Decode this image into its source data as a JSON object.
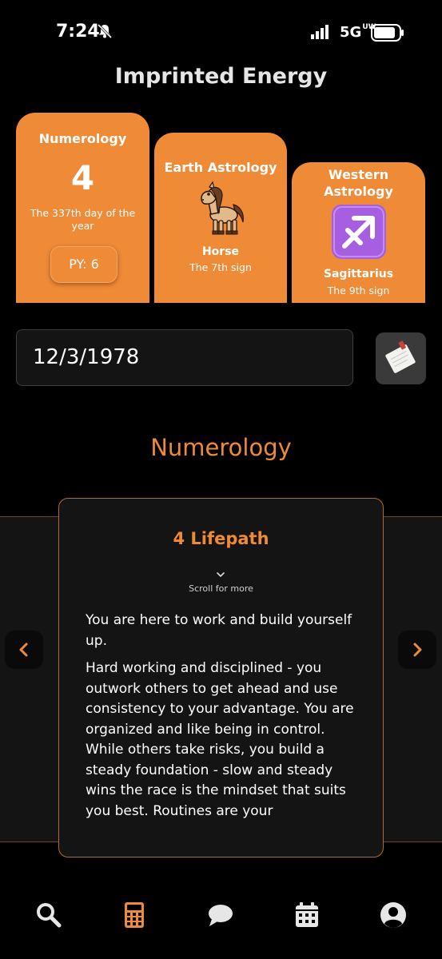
{
  "status_bar": {
    "time": "7:24",
    "network": "5G",
    "network_sup": "UW"
  },
  "page": {
    "title": "Imprinted Energy"
  },
  "cards": {
    "numerology": {
      "title": "Numerology",
      "number": "4",
      "subtitle": "The 337th day of the year",
      "py_label": "PY: 6"
    },
    "earth": {
      "title": "Earth Astrology",
      "icon": "horse-icon",
      "name": "Horse",
      "subtitle": "The 7th sign"
    },
    "western": {
      "title": "Western Astrology",
      "icon": "sagittarius-icon",
      "name": "Sagittarius",
      "subtitle": "The 9th sign"
    }
  },
  "date_input": {
    "value": "12/3/1978"
  },
  "section": {
    "title": "Numerology"
  },
  "panel": {
    "heading": "4 Lifepath",
    "hint": "Scroll for more",
    "paragraphs": [
      "You are here to work and build yourself up.",
      "Hard working and disciplined - you outwork others to get ahead and use consistency to your advantage. You are organized and like being in control. While others take risks, you build a steady foundation - slow and steady wins the race is the mindset that suits you best. Routines are your"
    ]
  },
  "bottom_nav": {
    "tabs": [
      "search-icon",
      "calculator-icon",
      "chat-icon",
      "calendar-icon",
      "account-icon"
    ],
    "active": "calculator-icon"
  },
  "colors": {
    "accent": "#ef8a36",
    "background": "#000000",
    "panel": "#141414",
    "purple": "#a65fe0"
  }
}
